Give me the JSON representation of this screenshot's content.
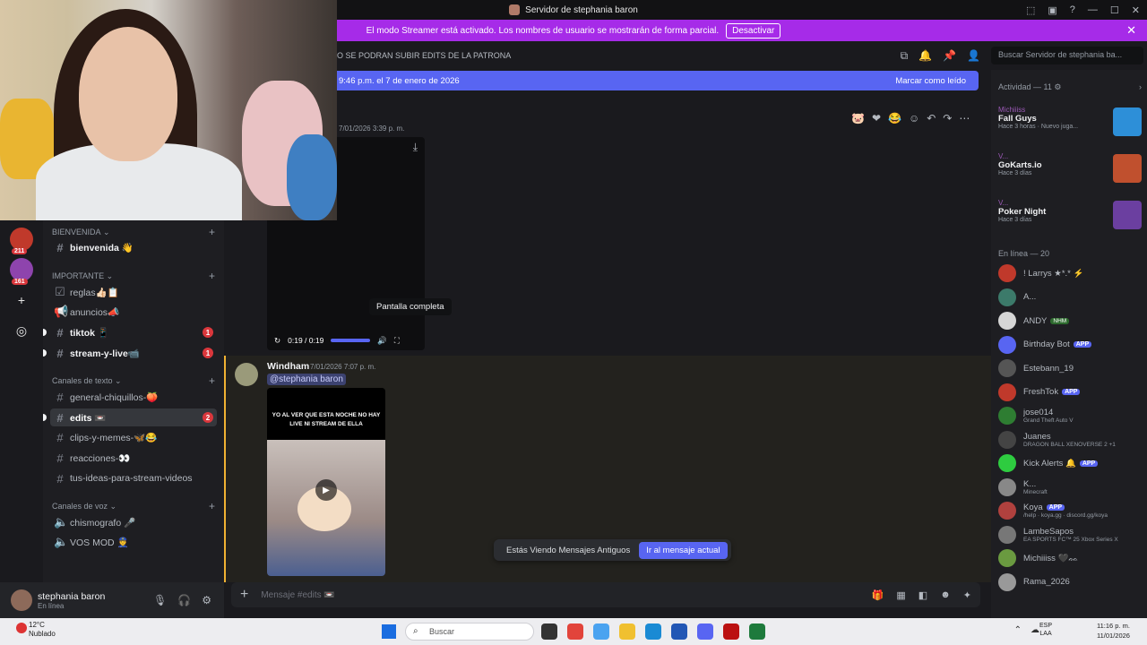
{
  "window": {
    "title": "Servidor de stephania baron"
  },
  "banner": {
    "text": "El modo Streamer está activado. Los nombres de usuario se mostrarán de forma parcial.",
    "button": "Desactivar",
    "close": "✕"
  },
  "servers": [
    {
      "badge": "211",
      "color": "#c0392b"
    },
    {
      "badge": "161",
      "color": "#8e44ad"
    }
  ],
  "channels": {
    "categories": {
      "bienvenida": "BIENVENIDA",
      "importante": "IMPORTANTE",
      "texto": "Canales de texto",
      "voz": "Canales de voz"
    },
    "items": {
      "bienvenida": "bienvenida 👋",
      "reglas": "reglas👍🏻📋",
      "anuncios": "anuncios📣",
      "tiktok": "tiktok 📱",
      "tiktok_badge": "1",
      "stream": "stream-y-live📹",
      "stream_badge": "1",
      "general": "general-chiquillos-🍑",
      "edits": "edits 📼",
      "edits_badge": "2",
      "clips": "clips-y-memes-🦋😂",
      "reacciones": "reacciones-👀",
      "ideas": "tus-ideas-para-stream-videos",
      "chismografo": "chismografo 🎤",
      "vos_mod": "VOS MOD 👮"
    }
  },
  "user": {
    "name": "stephania baron",
    "status": "En línea"
  },
  "topbar": {
    "topic": "O SE PODRAN SUBIR EDITS DE LA PATRONA",
    "search_placeholder": "Buscar Servidor de stephania ba..."
  },
  "newbar": {
    "text": "9:46 p.m. el 7 de enero de 2026",
    "mark_read": "Marcar como leído"
  },
  "messages": {
    "first_timestamp": "7/01/2026 3:39 p. m.",
    "video_time": "0:19 / 0:19",
    "tooltip": "Pantalla completa",
    "second_author": "Windham",
    "second_timestamp": "7/01/2026 7:07 p. m.",
    "mention": "@stephania baron",
    "caption": "YO AL VER QUE ESTA NOCHE NO HAY LIVE NI STREAM DE ELLA"
  },
  "jumpbar": {
    "text": "Estás Viendo Mensajes Antiguos",
    "button": "Ir al mensaje actual"
  },
  "composer": {
    "placeholder": "Mensaje #edits 📼"
  },
  "activity": {
    "header": "Actividad — 11 ⚙",
    "items": [
      {
        "who": "Michiiiss",
        "game": "Fall Guys",
        "meta": "Hace 3 horas · Nuevo juga...",
        "color": "#2d8fd8"
      },
      {
        "who": "V...",
        "game": "GoKarts.io",
        "meta": "Hace 3 días",
        "color": "#c0502e"
      },
      {
        "who": "V...",
        "game": "Poker Night",
        "meta": "Hace 3 días",
        "color": "#6b3fa0"
      }
    ]
  },
  "members": {
    "header": "En línea — 20",
    "list": [
      {
        "name": "! Larrys ★*.* ⚡",
        "sub": "",
        "color": "#c0392b",
        "tag": ""
      },
      {
        "name": "A...",
        "sub": "",
        "color": "#3c7a6a",
        "tag": ""
      },
      {
        "name": "ANDY",
        "sub": "",
        "color": "#d6d6d6",
        "tag": "NHM"
      },
      {
        "name": "Birthday Bot",
        "sub": "",
        "color": "#5865f2",
        "tag": "APP"
      },
      {
        "name": "Estebann_19",
        "sub": "",
        "color": "#555",
        "tag": ""
      },
      {
        "name": "FreshTok",
        "sub": "",
        "color": "#c0392b",
        "tag": "APP"
      },
      {
        "name": "jose014",
        "sub": "Grand Theft Auto V",
        "color": "#2e7d32",
        "tag": ""
      },
      {
        "name": "Juanes",
        "sub": "DRAGON BALL XENOVERSE 2 +1",
        "color": "#444",
        "tag": ""
      },
      {
        "name": "Kick Alerts 🔔",
        "sub": "",
        "color": "#2ecc40",
        "tag": "APP"
      },
      {
        "name": "K...",
        "sub": "Minecraft",
        "color": "#888",
        "tag": ""
      },
      {
        "name": "Koya",
        "sub": "/help · koya.gg · discord.gg/koya",
        "color": "#b0413e",
        "tag": "APP"
      },
      {
        "name": "LambeSapos",
        "sub": "EA SPORTS FC™ 25 Xbox Series X",
        "color": "#777",
        "tag": ""
      },
      {
        "name": "Michiiiss 🖤ᨐ",
        "sub": "",
        "color": "#6a9a40",
        "tag": ""
      },
      {
        "name": "Rama_2026",
        "sub": "",
        "color": "#999",
        "tag": ""
      }
    ]
  },
  "taskbar": {
    "temp": "12°C",
    "weather": "Nublado",
    "search": "Buscar",
    "lang1": "ESP",
    "lang2": "LAA",
    "time": "11:16 p. m.",
    "date": "11/01/2026"
  }
}
